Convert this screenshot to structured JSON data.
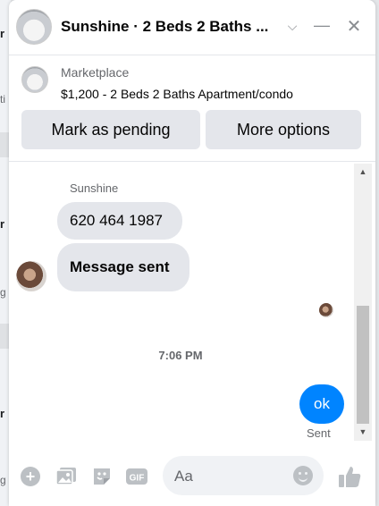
{
  "background": {
    "letters": [
      "r",
      "ti",
      "r",
      "g",
      "r",
      "g"
    ]
  },
  "header": {
    "title": "Sunshine · 2 Beds 2 Baths ...",
    "chevron": "⌵",
    "minimize": "—",
    "close": "✕"
  },
  "marketplace": {
    "label": "Marketplace",
    "listing": "$1,200 - 2 Beds 2 Baths Apartment/condo",
    "mark_pending": "Mark as pending",
    "more_options": "More options"
  },
  "conversation": {
    "sender_name": "Sunshine",
    "messages_in": [
      "620 464 1987",
      "Message sent"
    ],
    "timestamp": "7:06 PM",
    "message_out": "ok",
    "status": "Sent"
  },
  "composer": {
    "placeholder": "Aa",
    "gif_label": "GIF"
  },
  "colors": {
    "accent": "#0084ff",
    "bubble_in": "#e4e6eb"
  },
  "icons": [
    "house-icon",
    "chevron-down-icon",
    "minimize-icon",
    "close-icon",
    "plus-icon",
    "photo-icon",
    "sticker-icon",
    "gif-icon",
    "emoji-icon",
    "thumbs-up-icon"
  ]
}
